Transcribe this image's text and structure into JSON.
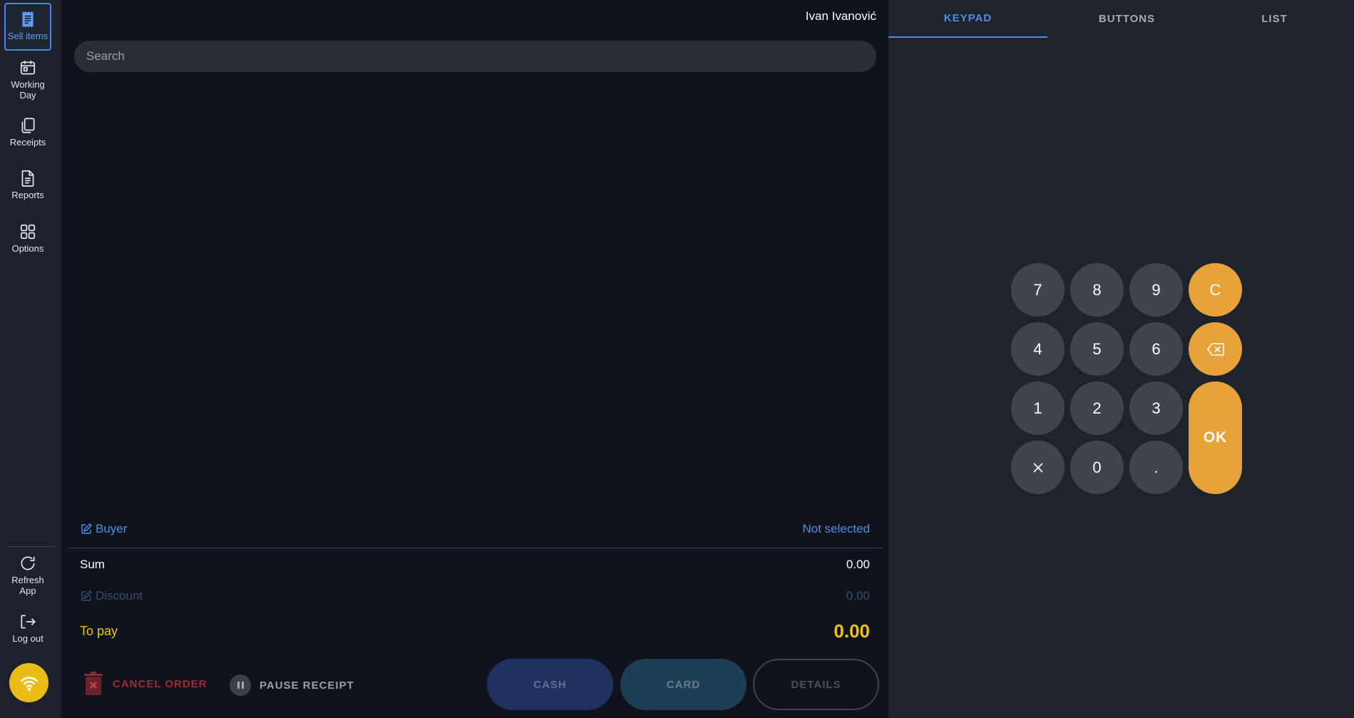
{
  "sidebar": {
    "items": [
      {
        "label": "Sell items",
        "icon": "receipt-icon",
        "active": true
      },
      {
        "label": "Working Day",
        "icon": "calendar-icon"
      },
      {
        "label": "Receipts",
        "icon": "copy-icon"
      },
      {
        "label": "Reports",
        "icon": "document-icon"
      },
      {
        "label": "Options",
        "icon": "grid-icon"
      }
    ],
    "bottom": [
      {
        "label": "Refresh App",
        "icon": "refresh-icon"
      },
      {
        "label": "Log out",
        "icon": "logout-icon"
      }
    ],
    "status_icon": "wifi-icon"
  },
  "header": {
    "user_name": "Ivan Ivanović"
  },
  "search": {
    "placeholder": "Search",
    "value": ""
  },
  "order": {
    "buyer_label": "Buyer",
    "buyer_value": "Not selected",
    "sum_label": "Sum",
    "sum_value": "0.00",
    "discount_label": "Discount",
    "discount_value": "0.00",
    "to_pay_label": "To pay",
    "to_pay_value": "0.00"
  },
  "actions": {
    "cancel_label": "CANCEL ORDER",
    "pause_label": "PAUSE RECEIPT",
    "cash_label": "CASH",
    "card_label": "CARD",
    "details_label": "DETAILS"
  },
  "tabs": [
    {
      "label": "KEYPAD",
      "active": true
    },
    {
      "label": "BUTTONS"
    },
    {
      "label": "LIST"
    }
  ],
  "keypad": {
    "keys": [
      "7",
      "8",
      "9",
      "C",
      "4",
      "5",
      "6",
      "1",
      "2",
      "3",
      "0",
      "."
    ],
    "ok_label": "OK"
  },
  "colors": {
    "accent": "#4c8eec",
    "orange": "#e8a23a",
    "to_pay": "#f2c200",
    "danger": "#9d2b33",
    "wifi": "#e9bd16"
  }
}
